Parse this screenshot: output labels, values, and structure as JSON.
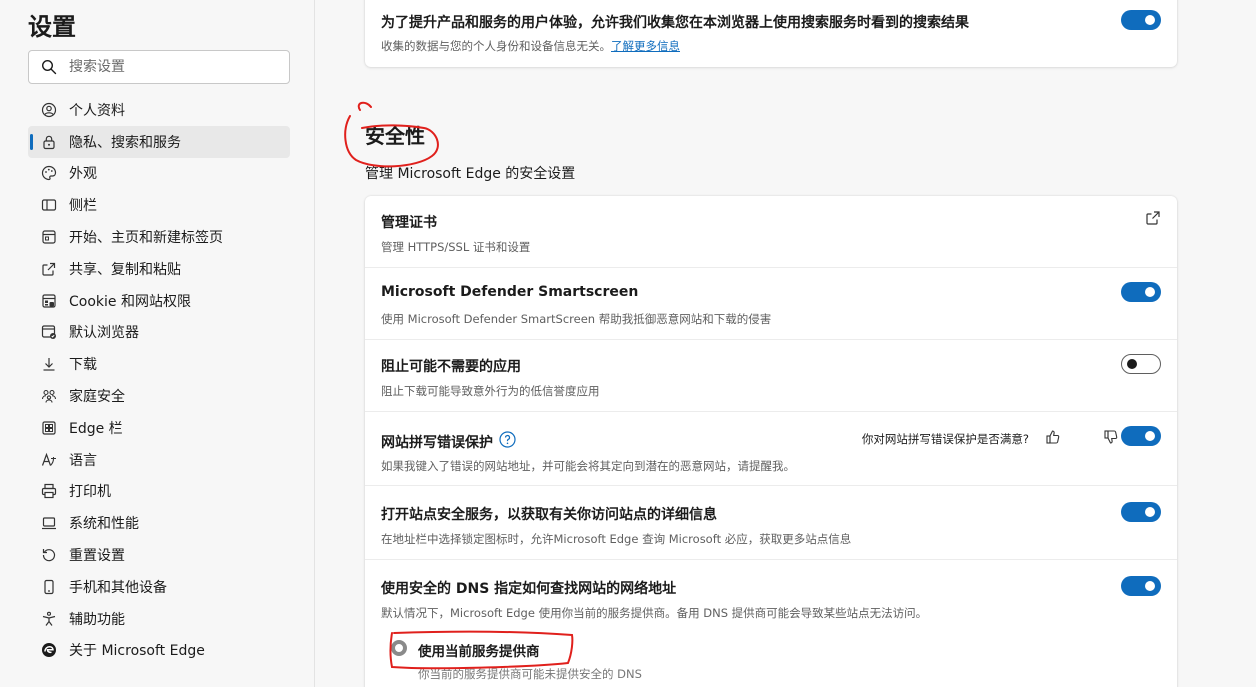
{
  "sidebar": {
    "title": "设置",
    "search_placeholder": "搜索设置",
    "items": [
      {
        "label": "个人资料",
        "icon": "profile-icon"
      },
      {
        "label": "隐私、搜索和服务",
        "icon": "lock-icon",
        "active": true
      },
      {
        "label": "外观",
        "icon": "palette-icon"
      },
      {
        "label": "侧栏",
        "icon": "sidebar-icon"
      },
      {
        "label": "开始、主页和新建标签页",
        "icon": "home-tab-icon"
      },
      {
        "label": "共享、复制和粘贴",
        "icon": "share-icon"
      },
      {
        "label": "Cookie 和网站权限",
        "icon": "cookie-icon"
      },
      {
        "label": "默认浏览器",
        "icon": "browser-icon"
      },
      {
        "label": "下载",
        "icon": "download-icon"
      },
      {
        "label": "家庭安全",
        "icon": "family-icon"
      },
      {
        "label": "Edge 栏",
        "icon": "edge-bar-icon"
      },
      {
        "label": "语言",
        "icon": "language-icon"
      },
      {
        "label": "打印机",
        "icon": "printer-icon"
      },
      {
        "label": "系统和性能",
        "icon": "laptop-icon"
      },
      {
        "label": "重置设置",
        "icon": "reset-icon"
      },
      {
        "label": "手机和其他设备",
        "icon": "phone-icon"
      },
      {
        "label": "辅助功能",
        "icon": "accessibility-icon"
      },
      {
        "label": "关于 Microsoft Edge",
        "icon": "edge-logo-icon"
      }
    ]
  },
  "top_card": {
    "title": "为了提升产品和服务的用户体验，允许我们收集您在本浏览器上使用搜索服务时看到的搜索结果",
    "desc": "收集的数据与您的个人身份和设备信息无关。",
    "link": "了解更多信息",
    "toggle_on": true
  },
  "security": {
    "title": "安全性",
    "subtitle": "管理 Microsoft Edge 的安全设置",
    "rows": [
      {
        "title": "管理证书",
        "desc": "管理 HTTPS/SSL 证书和设置"
      },
      {
        "title": "Microsoft Defender Smartscreen",
        "desc": "使用 Microsoft Defender SmartScreen 帮助我抵御恶意网站和下载的侵害",
        "toggle_on": true
      },
      {
        "title": "阻止可能不需要的应用",
        "desc": "阻止下载可能导致意外行为的低信誉度应用",
        "toggle_on": false
      },
      {
        "title": "网站拼写错误保护",
        "desc": "如果我键入了错误的网站地址，并可能会将其定向到潜在的恶意网站，请提醒我。",
        "feedback": "你对网站拼写错误保护是否满意?",
        "toggle_on": true
      },
      {
        "title": "打开站点安全服务，以获取有关你访问站点的详细信息",
        "desc": "在地址栏中选择锁定图标时，允许Microsoft Edge 查询 Microsoft 必应，获取更多站点信息",
        "toggle_on": true
      },
      {
        "title": "使用安全的 DNS 指定如何查找网站的网络地址",
        "desc": "默认情况下，Microsoft Edge 使用你当前的服务提供商。备用 DNS 提供商可能会导致某些站点无法访问。",
        "toggle_on": true
      }
    ],
    "dns_option": {
      "label": "使用当前服务提供商",
      "desc": "你当前的服务提供商可能未提供安全的 DNS"
    }
  },
  "colors": {
    "accent": "#0f6cbd",
    "annotation": "#e0201c"
  }
}
